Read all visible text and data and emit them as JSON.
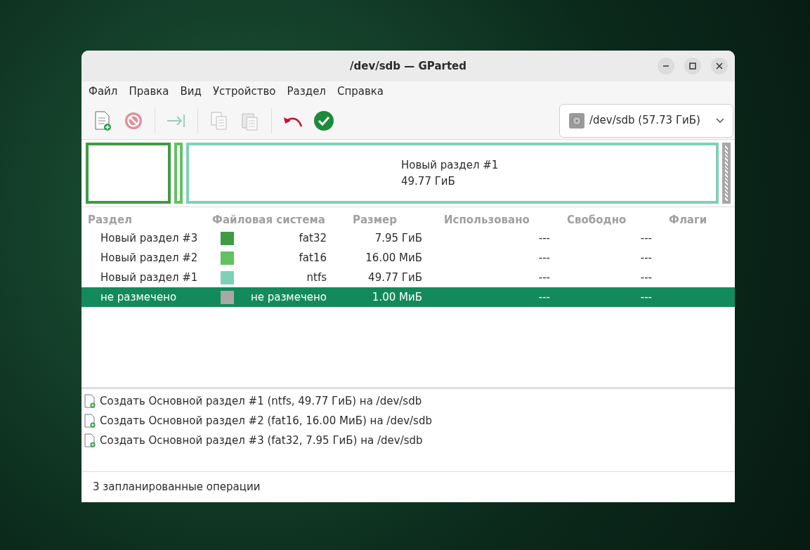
{
  "window": {
    "title": "/dev/sdb — GParted"
  },
  "menu": [
    "Файл",
    "Правка",
    "Вид",
    "Устройство",
    "Раздел",
    "Справка"
  ],
  "toolbar": [
    {
      "kind": "new",
      "disabled": false
    },
    {
      "kind": "delete",
      "disabled": true
    },
    {
      "kind": "sep"
    },
    {
      "kind": "resize",
      "disabled": true
    },
    {
      "kind": "sep"
    },
    {
      "kind": "copy",
      "disabled": true
    },
    {
      "kind": "paste",
      "disabled": true
    },
    {
      "kind": "sep"
    },
    {
      "kind": "undo",
      "disabled": false
    },
    {
      "kind": "apply",
      "disabled": false
    }
  ],
  "device": {
    "label": "/dev/sdb (57.73 ГиБ)"
  },
  "disk_map": [
    {
      "kind": "medium",
      "color": "#3f9b44"
    },
    {
      "kind": "narrow",
      "color": "#62c262"
    },
    {
      "kind": "wide",
      "color": "#7fd1b6",
      "lines": [
        "Новый раздел #1",
        "49.77 ГиБ"
      ]
    },
    {
      "kind": "unallocated",
      "color": "#a8a8a8"
    }
  ],
  "table": {
    "columns": [
      "Раздел",
      "Файловая система",
      "Размер",
      "Использовано",
      "Свободно",
      "Флаги"
    ],
    "rows": [
      {
        "name": "Новый раздел #3",
        "color": "#3f9b44",
        "filesystem": "fat32",
        "size": "7.95 ГиБ",
        "used": "---",
        "free": "---",
        "selected": false
      },
      {
        "name": "Новый раздел #2",
        "color": "#62c262",
        "filesystem": "fat16",
        "size": "16.00 МиБ",
        "used": "---",
        "free": "---",
        "selected": false
      },
      {
        "name": "Новый раздел #1",
        "color": "#7fd1b6",
        "filesystem": "ntfs",
        "size": "49.77 ГиБ",
        "used": "---",
        "free": "---",
        "selected": false
      },
      {
        "name": "не размечено",
        "color": "#a8a8a8",
        "filesystem": "не размечено",
        "size": "1.00 МиБ",
        "used": "---",
        "free": "---",
        "selected": true
      }
    ]
  },
  "operations": [
    "Создать Основной раздел #1 (ntfs, 49.77 ГиБ) на /dev/sdb",
    "Создать Основной раздел #2 (fat16, 16.00 МиБ) на /dev/sdb",
    "Создать Основной раздел #3 (fat32, 7.95 ГиБ) на /dev/sdb"
  ],
  "status_bar": "3 запланированные операции"
}
